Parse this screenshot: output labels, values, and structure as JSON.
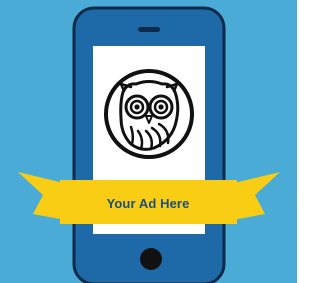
{
  "banner": {
    "text": "Your Ad Here"
  },
  "icons": {
    "logo": "owl-logo-icon",
    "home_button": "home-button-icon",
    "speaker": "speaker-icon",
    "phone": "smartphone-icon",
    "ribbon": "ribbon-banner-icon"
  },
  "colors": {
    "background": "#4AACD6",
    "phone_body": "#1E6AA8",
    "phone_outline": "#0D2A4A",
    "screen": "#FFFFFF",
    "ribbon": "#F8CD14",
    "ribbon_dark": "#C89C0A",
    "ad_text": "#1E4E7A",
    "ink": "#111111"
  }
}
